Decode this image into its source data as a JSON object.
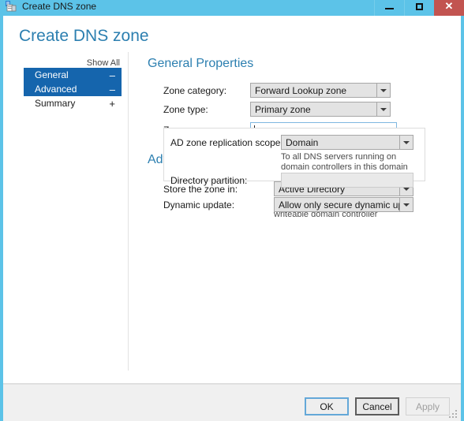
{
  "window": {
    "title": "Create DNS zone",
    "icon": "dns-zone-icon",
    "accent_color": "#5cc3e8",
    "close_color": "#c25450",
    "controls": {
      "minimize": "minimize-icon",
      "maximize": "maximize-icon",
      "close": "✕"
    }
  },
  "page_title": "Create DNS zone",
  "nav": {
    "show_all": "Show All",
    "items": [
      {
        "label": "General",
        "sign": "–",
        "selected": true
      },
      {
        "label": "Advanced",
        "sign": "–",
        "selected": true
      },
      {
        "label": "Summary",
        "sign": "+",
        "selected": false
      }
    ]
  },
  "general": {
    "heading": "General Properties",
    "zone_category": {
      "label": "Zone category:",
      "value": "Forward Lookup zone"
    },
    "zone_type": {
      "label": "Zone type:",
      "value": "Primary zone"
    },
    "zone_name": {
      "label": "Zone name:",
      "value": "",
      "placeholder": ""
    }
  },
  "advanced": {
    "heading": "Advanced Properties",
    "store_zone_in": {
      "label": "Store the zone in:",
      "value": "Active Directory",
      "hint": "Available only if DNS server is a writeable domain controller"
    },
    "ad_replication_scope": {
      "label": "AD zone replication scope:",
      "value": "Domain",
      "hint": "To all DNS servers running on domain controllers in this domain"
    },
    "directory_partition": {
      "label": "Directory partition:",
      "value": ""
    },
    "dynamic_update": {
      "label": "Dynamic update:",
      "value": "Allow only secure dynamic updates (rec"
    }
  },
  "footer": {
    "ok": "OK",
    "cancel": "Cancel",
    "apply": "Apply"
  }
}
